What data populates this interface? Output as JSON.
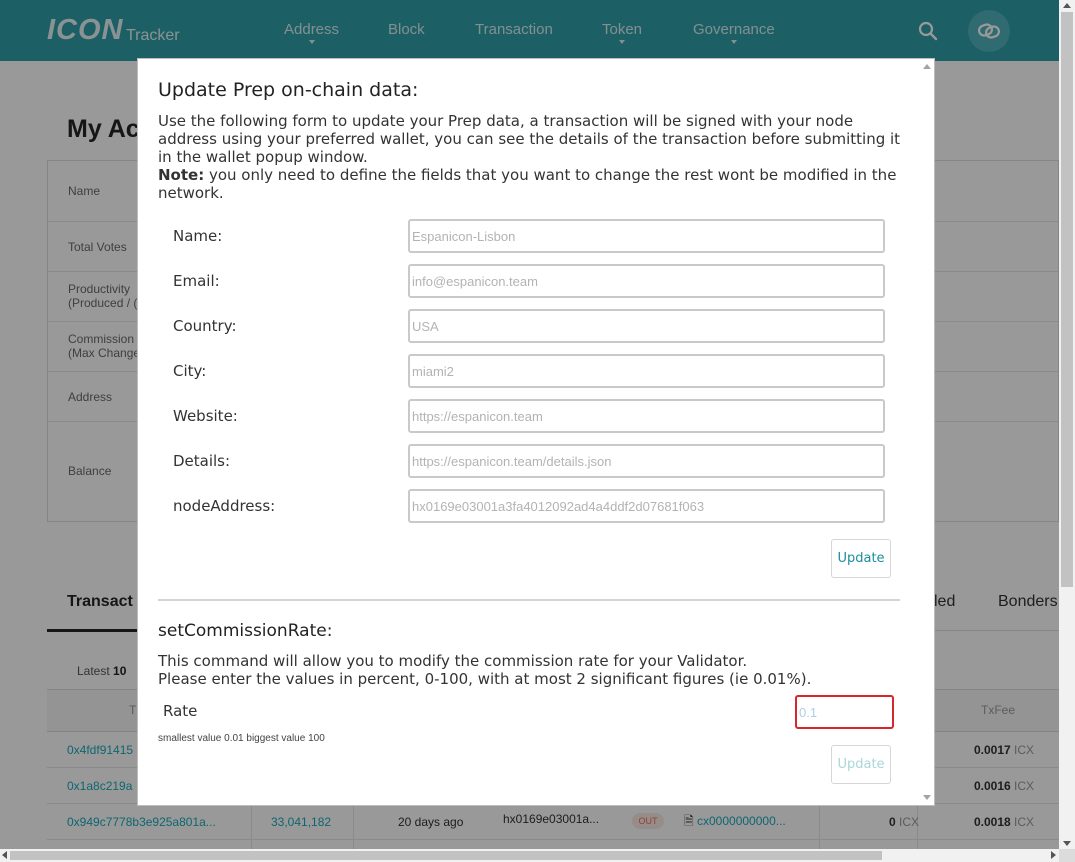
{
  "header": {
    "logo": "ICON",
    "logo_sub": "Tracker",
    "nav": [
      "Address",
      "Block",
      "Transaction",
      "Token",
      "Governance"
    ]
  },
  "background": {
    "page_title": "My Ac",
    "info_labels": {
      "name": "Name",
      "total_votes": "Total Votes",
      "productivity_1": "Productivity",
      "productivity_2": "(Produced / (",
      "commission_1": "Commission",
      "commission_2": "(Max Change",
      "address": "Address",
      "balance": "Balance"
    },
    "tab_active": "Transact",
    "tab_right_1": "led",
    "tab_right_2": "Bonders",
    "latest_prefix": "Latest",
    "latest_count": "10",
    "txfee_header": "TxFee",
    "tx_head_first": "T",
    "rows": [
      {
        "hash": "0x4fdf91415",
        "fee": "0.0017",
        "unit": "ICX"
      },
      {
        "hash": "0x1a8c219a",
        "fee": "0.0016",
        "unit": "ICX"
      },
      {
        "hash": "0x949c7778b3e925a801a...",
        "block": "33,041,182",
        "age": "20 days ago",
        "from": "hx0169e03001a...",
        "direction": "OUT",
        "to": "cx0000000000...",
        "amount": "0",
        "amount_unit": "ICX",
        "fee": "0.0018",
        "unit": "ICX"
      }
    ]
  },
  "modal": {
    "title": "Update Prep on-chain data:",
    "description": "Use the following form to update your Prep data, a transaction will be signed with your node address using your preferred wallet, you can see the details of the transaction before submitting it in the wallet popup window.",
    "note_label": "Note:",
    "note_text": " you only need to define the fields that you want to change the rest wont be modified in the network.",
    "fields": {
      "name": {
        "label": "Name:",
        "placeholder": "Espanicon-Lisbon"
      },
      "email": {
        "label": "Email:",
        "placeholder": "info@espanicon.team"
      },
      "country": {
        "label": "Country:",
        "placeholder": "USA"
      },
      "city": {
        "label": "City:",
        "placeholder": "miami2"
      },
      "website": {
        "label": "Website:",
        "placeholder": "https://espanicon.team"
      },
      "details": {
        "label": "Details:",
        "placeholder": "https://espanicon.team/details.json"
      },
      "node_address": {
        "label": "nodeAddress:",
        "placeholder": "hx0169e03001a3fa4012092ad4a4ddf2d07681f063"
      }
    },
    "update_label": "Update",
    "commission": {
      "title": "setCommissionRate:",
      "line1": "This command will allow you to modify the commission rate for your Validator.",
      "line2": "Please enter the values in percent, 0-100, with at most 2 significant figures (ie 0.01%).",
      "rate_label": "Rate",
      "rate_placeholder": "0.1",
      "hint": "smallest value 0.01 biggest value 100",
      "update_label": "Update"
    }
  }
}
